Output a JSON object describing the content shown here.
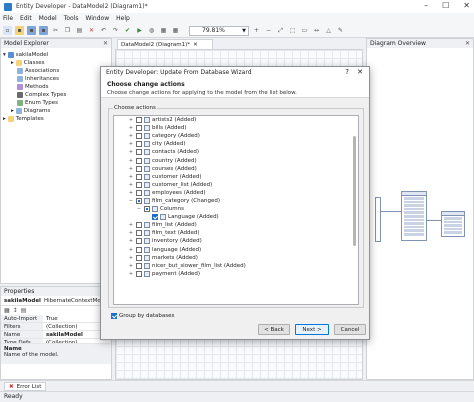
{
  "window": {
    "title": "Entity Developer - DataModel2 (Diagram1)*",
    "controls": [
      "–",
      "☐",
      "✕"
    ]
  },
  "menu": [
    "File",
    "Edit",
    "Model",
    "Tools",
    "Window",
    "Help"
  ],
  "toolbar": {
    "zoom": "79.81%"
  },
  "model_explorer": {
    "title": "Model Explorer",
    "items": [
      {
        "label": "sakilaModel",
        "icon": "model-icon",
        "level": 0
      },
      {
        "label": "Classes",
        "icon": "folder-icon",
        "level": 1
      },
      {
        "label": "Associations",
        "icon": "association-icon",
        "level": 1
      },
      {
        "label": "Inheritances",
        "icon": "inheritance-icon",
        "level": 1
      },
      {
        "label": "Methods",
        "icon": "method-icon",
        "level": 1
      },
      {
        "label": "Complex Types",
        "icon": "complex-type-icon",
        "level": 1
      },
      {
        "label": "Enum Types",
        "icon": "enum-icon",
        "level": 1
      },
      {
        "label": "Diagrams",
        "icon": "diagram-icon",
        "level": 1
      },
      {
        "label": "Templates",
        "icon": "template-icon",
        "level": 0
      }
    ]
  },
  "document_tab": {
    "label": "DataModel2 (Diagram1)*"
  },
  "diagram_overview": {
    "title": "Diagram Overview"
  },
  "properties": {
    "title": "Properties",
    "object": "sakilaModel",
    "object_type": "HibernateContextModel",
    "rows": [
      {
        "key": "Auto-Import",
        "value": "True"
      },
      {
        "key": "Filters",
        "value": "(Collection)"
      },
      {
        "key": "Name",
        "value": "sakilaModel"
      },
      {
        "key": "Type Defs",
        "value": "(Collection)"
      }
    ],
    "desc_title": "Name",
    "desc_text": "Name of the model."
  },
  "error_list": {
    "label": "Error List"
  },
  "status": {
    "text": "Ready"
  },
  "dialog": {
    "title": "Entity Developer: Update From Database Wizard",
    "help": "?",
    "close": "✕",
    "header_title": "Choose change actions",
    "header_desc": "Choose change actions for applying to the model from the list below.",
    "group_label": "Choose actions",
    "items": [
      {
        "label": "artists2 (Added)",
        "level": 0,
        "expand": "+",
        "state": "off"
      },
      {
        "label": "bills (Added)",
        "level": 0,
        "expand": "+",
        "state": "off"
      },
      {
        "label": "category (Added)",
        "level": 0,
        "expand": "+",
        "state": "off"
      },
      {
        "label": "city (Added)",
        "level": 0,
        "expand": "+",
        "state": "off"
      },
      {
        "label": "contacts (Added)",
        "level": 0,
        "expand": "+",
        "state": "off"
      },
      {
        "label": "country (Added)",
        "level": 0,
        "expand": "+",
        "state": "off"
      },
      {
        "label": "courses (Added)",
        "level": 0,
        "expand": "+",
        "state": "off"
      },
      {
        "label": "customer (Added)",
        "level": 0,
        "expand": "+",
        "state": "off"
      },
      {
        "label": "customer_list (Added)",
        "level": 0,
        "expand": "+",
        "state": "off"
      },
      {
        "label": "employees (Added)",
        "level": 0,
        "expand": "+",
        "state": "off"
      },
      {
        "label": "film_category (Changed)",
        "level": 0,
        "expand": "−",
        "state": "part"
      },
      {
        "label": "Columns",
        "level": 1,
        "expand": "−",
        "state": "part"
      },
      {
        "label": "Language (Added)",
        "level": 2,
        "expand": "",
        "state": "on"
      },
      {
        "label": "film_list (Added)",
        "level": 0,
        "expand": "+",
        "state": "off"
      },
      {
        "label": "film_text (Added)",
        "level": 0,
        "expand": "+",
        "state": "off"
      },
      {
        "label": "inventory (Added)",
        "level": 0,
        "expand": "+",
        "state": "off"
      },
      {
        "label": "language (Added)",
        "level": 0,
        "expand": "+",
        "state": "off"
      },
      {
        "label": "markets (Added)",
        "level": 0,
        "expand": "+",
        "state": "off"
      },
      {
        "label": "nicer_but_slower_film_list (Added)",
        "level": 0,
        "expand": "+",
        "state": "off"
      },
      {
        "label": "payment (Added)",
        "level": 0,
        "expand": "+",
        "state": "off"
      }
    ],
    "group_by": {
      "label": "Group by databases",
      "checked": true
    },
    "buttons": {
      "back": "< Back",
      "next": "Next >",
      "cancel": "Cancel"
    }
  },
  "colors": {
    "accent": "#0078d7",
    "check": "#1e6fc9"
  }
}
